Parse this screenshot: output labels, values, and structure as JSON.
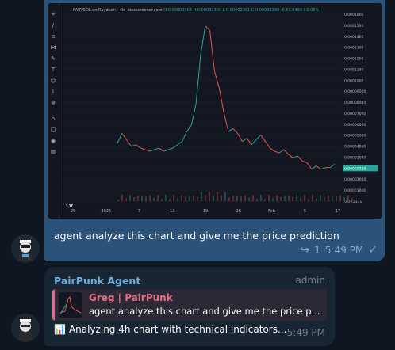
{
  "chart": {
    "header_pair": "PAIR/SOL on Raydium · 4h · dexscreener.com",
    "header_ohlc": "O 0.00002364  H 0.00002360  L 0.00002361  C 0.00002389  -6.63.6499 (-0.06%)",
    "y_ticks": [
      "0.0001600",
      "0.0001500",
      "0.0001400",
      "0.0001300",
      "0.0001200",
      "0.0001100",
      "0.0001000",
      "0.00009000",
      "0.00008000",
      "0.00007000",
      "0.00006000",
      "0.00005000",
      "0.00004000",
      "0.00003000",
      "0.00002389",
      "0.00002000",
      "0.00001000",
      "0.0+2371"
    ],
    "x_ticks": [
      "25",
      "2026",
      "7",
      "13",
      "19",
      "26",
      "Feb",
      "9",
      "17"
    ],
    "watermark": "TV",
    "last_price": "0.00002389"
  },
  "message1": {
    "text": "agent analyze this chart and give me the price prediction",
    "reply_count": "1",
    "time": "5:49 PM"
  },
  "message2": {
    "sender": "PairPunk Agent",
    "role": "admin",
    "quote_author": "Greg | PairPunk",
    "quote_text": "agent analyze this chart and give me the price p...",
    "status_icon": "📊",
    "status_text": "Analyzing 4h chart with technical indicators...",
    "time": "5:49 PM"
  },
  "colors": {
    "background": "#0e1621",
    "outgoing_bubble": "#2b5278",
    "incoming_bubble": "#182533",
    "sender": "#6bb0e3",
    "quote_accent": "#e06f83",
    "candle_up": "#26a69a",
    "candle_down": "#ef5350"
  },
  "icons": {
    "reply": "reply-arrow-icon",
    "read": "checkmark-icon",
    "chart": "bar-chart-icon"
  }
}
